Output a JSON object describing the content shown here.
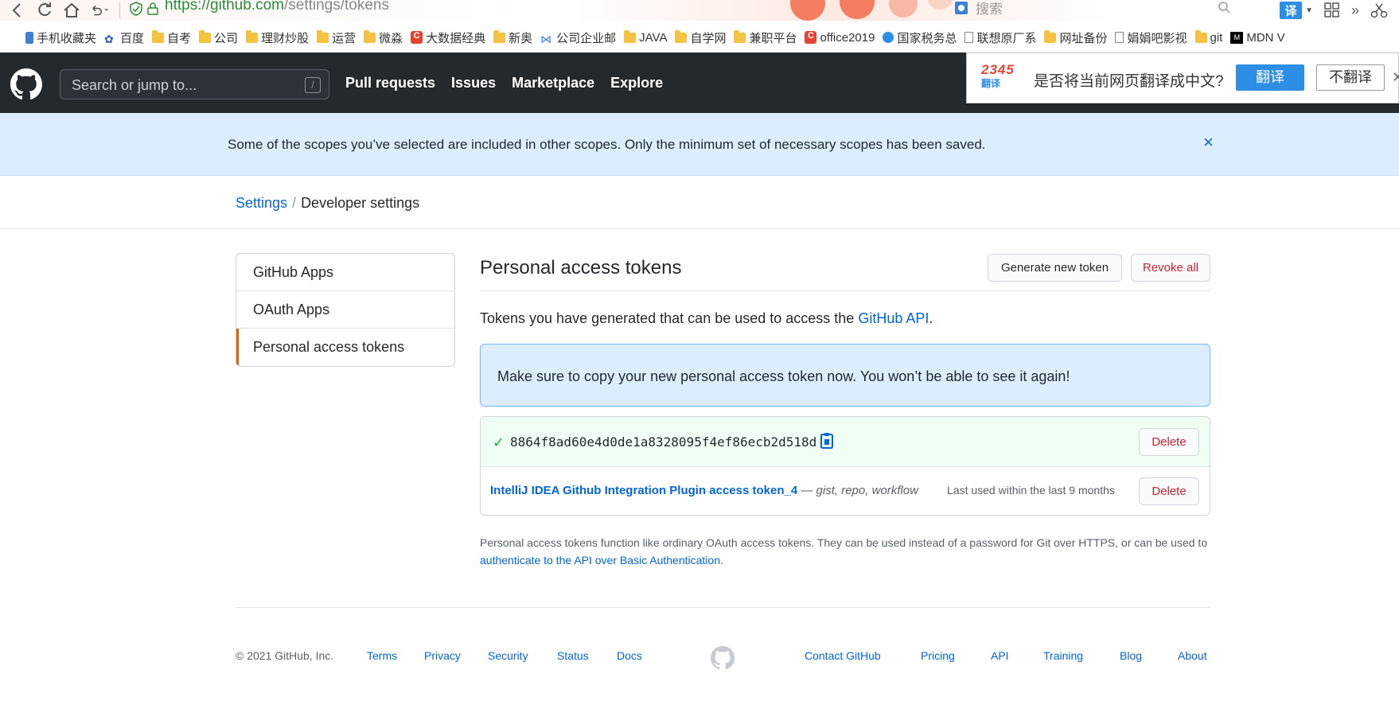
{
  "browser": {
    "url_host": "https://github.com",
    "url_path": "/settings/tokens",
    "search_placeholder": "搜索",
    "translate_badge": "译",
    "bookmarks": [
      {
        "label": "手机收藏夹",
        "icon": "phone"
      },
      {
        "label": "百度",
        "icon": "paw"
      },
      {
        "label": "自考",
        "icon": "folder"
      },
      {
        "label": "公司",
        "icon": "folder"
      },
      {
        "label": "理财炒股",
        "icon": "folder"
      },
      {
        "label": "运营",
        "icon": "folder"
      },
      {
        "label": "微淼",
        "icon": "folder"
      },
      {
        "label": "大数据经典",
        "icon": "red"
      },
      {
        "label": "新奥",
        "icon": "folder"
      },
      {
        "label": "公司企业邮",
        "icon": "blue"
      },
      {
        "label": "JAVA",
        "icon": "folder"
      },
      {
        "label": "自学网",
        "icon": "folder"
      },
      {
        "label": "兼职平台",
        "icon": "folder"
      },
      {
        "label": "office2019",
        "icon": "red"
      },
      {
        "label": "国家税务总",
        "icon": "globe"
      },
      {
        "label": "联想原厂系",
        "icon": "page"
      },
      {
        "label": "网址备份",
        "icon": "folder"
      },
      {
        "label": "娟娟吧影视",
        "icon": "page"
      },
      {
        "label": "git",
        "icon": "folder"
      },
      {
        "label": "MDN V",
        "icon": "mdn"
      }
    ]
  },
  "header": {
    "search_placeholder": "Search or jump to...",
    "slash_hint": "/",
    "nav": [
      "Pull requests",
      "Issues",
      "Marketplace",
      "Explore"
    ]
  },
  "translate_bar": {
    "logo_number": "2345",
    "logo_text": "翻译",
    "question": "是否将当前网页翻译成中文?",
    "yes_label": "翻译",
    "no_label": "不翻译"
  },
  "flash": {
    "message": "Some of the scopes you’ve selected are included in other scopes. Only the minimum set of necessary scopes has been saved.",
    "close_glyph": "×"
  },
  "breadcrumb": {
    "root": "Settings",
    "separator": "/",
    "current": "Developer settings"
  },
  "sidebar": {
    "items": [
      {
        "label": "GitHub Apps",
        "selected": false
      },
      {
        "label": "OAuth Apps",
        "selected": false
      },
      {
        "label": "Personal access tokens",
        "selected": true
      }
    ]
  },
  "main": {
    "title": "Personal access tokens",
    "generate_label": "Generate new token",
    "revoke_label": "Revoke all",
    "intro_prefix": "Tokens you have generated that can be used to access the ",
    "intro_link": "GitHub API",
    "intro_suffix": ".",
    "notice": "Make sure to copy your new personal access token now. You won’t be able to see it again!",
    "new_token": {
      "value": "8864f8ad60e4d0de1a8328095f4ef86ecb2d518d",
      "delete_label": "Delete"
    },
    "tokens": [
      {
        "name": "IntelliJ IDEA Github Integration Plugin access token_4",
        "dash": " — ",
        "scopes": "gist, repo, workflow",
        "last_used": "Last used within the last 9 months",
        "delete_label": "Delete"
      }
    ],
    "footnote_prefix": "Personal access tokens function like ordinary OAuth access tokens. They can be used instead of a password for Git over HTTPS, or can be used to ",
    "footnote_link": "authenticate to the API over Basic Authentication",
    "footnote_suffix": "."
  },
  "footer": {
    "copyright": "© 2021 GitHub, Inc.",
    "left_links": [
      "Terms",
      "Privacy",
      "Security",
      "Status",
      "Docs"
    ],
    "right_links": [
      "Contact GitHub",
      "Pricing",
      "API",
      "Training",
      "Blog",
      "About"
    ]
  },
  "colors": {
    "header_bg": "#24292e",
    "link": "#0366d6",
    "danger": "#cb2431",
    "flash_bg": "#dbedff",
    "success_bg": "#f0fff4",
    "selected_marker": "#e36209"
  }
}
